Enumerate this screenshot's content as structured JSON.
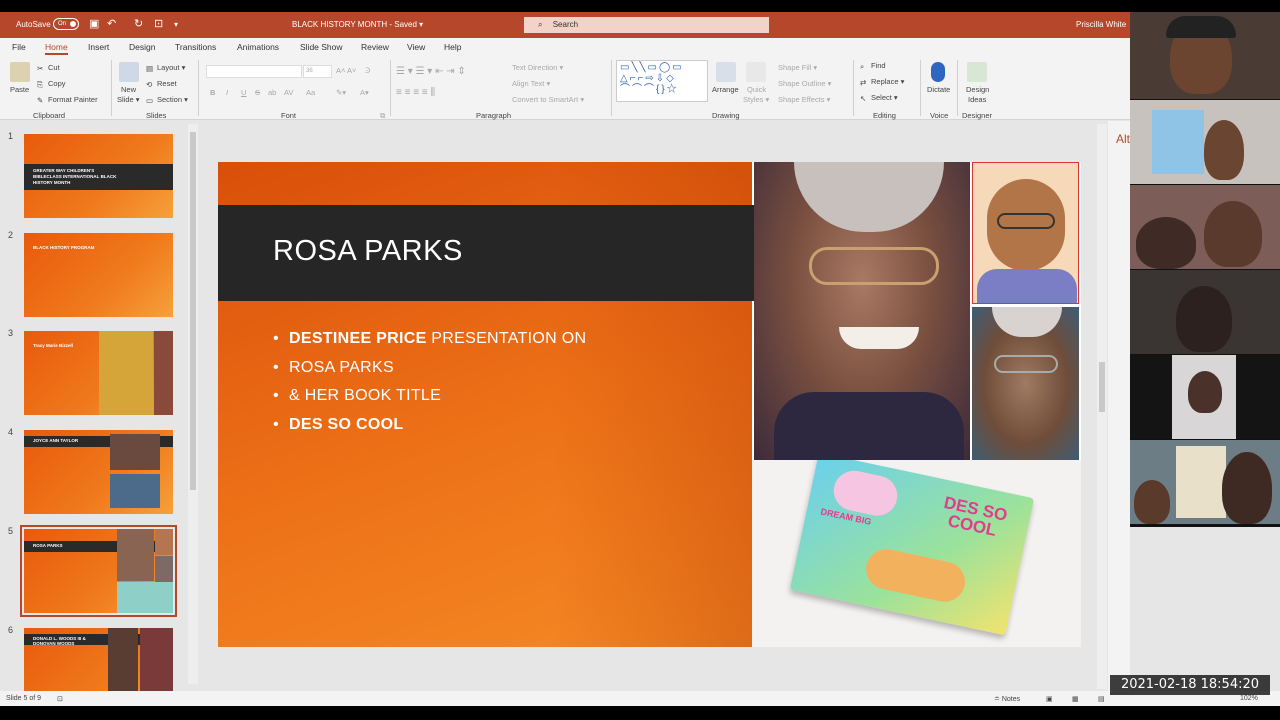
{
  "titlebar": {
    "autosave_label": "AutoSave",
    "autosave_state": "On",
    "document_title": "BLACK HISTORY MONTH  -  Saved  ▾",
    "search_placeholder": "Search",
    "user_name": "Priscilla White"
  },
  "menu": {
    "tabs": [
      {
        "label": "File"
      },
      {
        "label": "Home"
      },
      {
        "label": "Insert"
      },
      {
        "label": "Design"
      },
      {
        "label": "Transitions"
      },
      {
        "label": "Animations"
      },
      {
        "label": "Slide Show"
      },
      {
        "label": "Review"
      },
      {
        "label": "View"
      },
      {
        "label": "Help"
      }
    ],
    "active_tab": "Home"
  },
  "ribbon": {
    "clipboard": {
      "paste": "Paste",
      "cut": "Cut",
      "copy": "Copy",
      "format_painter": "Format Painter",
      "label": "Clipboard"
    },
    "slides": {
      "new_slide": "New",
      "new_slide2": "Slide ▾",
      "layout": "Layout ▾",
      "reset": "Reset",
      "section": "Section ▾",
      "label": "Slides"
    },
    "font": {
      "size": "36",
      "bold": "B",
      "italic": "I",
      "underline": "U",
      "strike": "S",
      "shadow": "ab",
      "spacing": "AV",
      "case": "Aa",
      "label": "Font"
    },
    "paragraph": {
      "text_direction": "Text Direction ▾",
      "align_text": "Align Text ▾",
      "smartart": "Convert to SmartArt ▾",
      "label": "Paragraph"
    },
    "drawing": {
      "arrange": "Arrange",
      "quick_styles": "Quick",
      "quick_styles2": "Styles ▾",
      "shape_fill": "Shape Fill ▾",
      "shape_outline": "Shape Outline ▾",
      "shape_effects": "Shape Effects ▾",
      "label": "Drawing"
    },
    "editing": {
      "find": "Find",
      "replace": "Replace ▾",
      "select": "Select ▾",
      "label": "Editing"
    },
    "voice": {
      "dictate": "Dictate",
      "label": "Voice"
    },
    "designer": {
      "design_ideas": "Design",
      "design_ideas2": "Ideas",
      "label": "Designer"
    }
  },
  "thumbnails": [
    {
      "number": "1",
      "title": "GREATER WAY CHILDREN'S BIBLECLASS INTERNATIONAL BLACK HISTORY MONTH"
    },
    {
      "number": "2",
      "title": "BLACK HISTORY PROGRAM"
    },
    {
      "number": "3",
      "title": "Tracy Marie Bizzell"
    },
    {
      "number": "4",
      "title": "JOYCE ANN TAYLOR"
    },
    {
      "number": "5",
      "title": "ROSA PARKS"
    },
    {
      "number": "6",
      "title": "DONALD L. WOODS III & DONOVAN WOODS"
    }
  ],
  "slide": {
    "title": "ROSA PARKS",
    "bullets": [
      {
        "bold": "DESTINEE PRICE",
        "rest": " PRESENTATION ON"
      },
      {
        "bold": "",
        "rest": "ROSA PARKS"
      },
      {
        "bold": "",
        "rest": "& HER BOOK TITLE"
      },
      {
        "bold": "",
        "rest": " DES SO COOL"
      }
    ],
    "book_title": "DES SO COOL",
    "book_subtitle": "DREAM BIG"
  },
  "alt_pane": {
    "heading": "Alt"
  },
  "statusbar": {
    "slide_counter": "Slide 5 of 9",
    "notes": "Notes",
    "zoom": "102%"
  },
  "timestamp": "2021-02-18  18:54:20",
  "colors": {
    "accent": "#b7472a",
    "slide_orange": "#ee7218",
    "title_band": "#262626"
  }
}
